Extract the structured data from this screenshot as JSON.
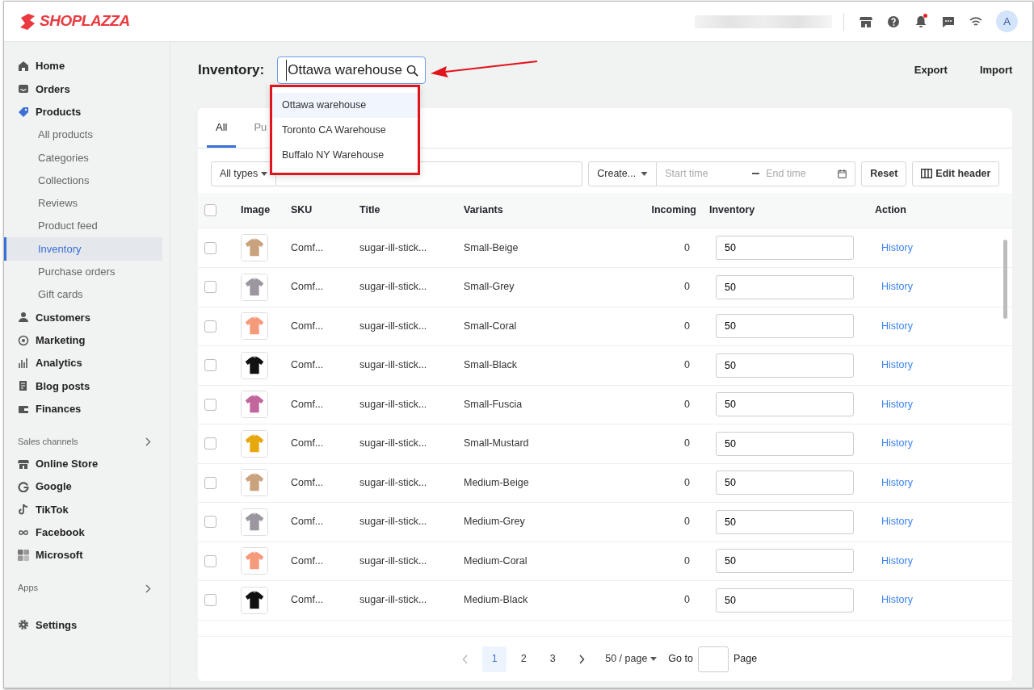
{
  "brand": {
    "name": "SHOPLAZZA"
  },
  "topbar": {
    "avatar": "A",
    "unread": true
  },
  "sidebar": {
    "items": [
      {
        "label": "Home",
        "selected": false
      },
      {
        "label": "Orders",
        "selected": false
      },
      {
        "label": "Products",
        "selected": false,
        "expanded": true,
        "children": [
          {
            "label": "All products",
            "selected": false
          },
          {
            "label": "Categories",
            "selected": false
          },
          {
            "label": "Collections",
            "selected": false
          },
          {
            "label": "Reviews",
            "selected": false
          },
          {
            "label": "Product feed",
            "selected": false
          },
          {
            "label": "Inventory",
            "selected": true
          },
          {
            "label": "Purchase orders",
            "selected": false
          },
          {
            "label": "Gift cards",
            "selected": false
          }
        ]
      },
      {
        "label": "Customers",
        "selected": false
      },
      {
        "label": "Marketing",
        "selected": false
      },
      {
        "label": "Analytics",
        "selected": false
      },
      {
        "label": "Blog posts",
        "selected": false
      },
      {
        "label": "Finances",
        "selected": false
      }
    ],
    "sections": [
      {
        "title": "Sales channels",
        "items": [
          {
            "label": "Online Store"
          },
          {
            "label": "Google"
          },
          {
            "label": "TikTok"
          },
          {
            "label": "Facebook"
          },
          {
            "label": "Microsoft"
          }
        ]
      },
      {
        "title": "Apps"
      }
    ],
    "footer_items": [
      {
        "label": "Settings"
      }
    ]
  },
  "page": {
    "title": "Inventory:",
    "location_search": {
      "value": "Ottawa warehouse"
    },
    "location_options": [
      {
        "label": "Ottawa warehouse",
        "selected": true
      },
      {
        "label": "Toronto CA Warehouse",
        "selected": false
      },
      {
        "label": "Buffalo NY Warehouse",
        "selected": false
      }
    ],
    "actions": [
      "Export",
      "Import"
    ]
  },
  "tabs": [
    {
      "label": "All",
      "selected": true
    },
    {
      "label": "Pu",
      "selected": false
    }
  ],
  "filters": {
    "type_select": "All types",
    "date_field_select": "Create...",
    "start_placeholder": "Start time",
    "end_placeholder": "End time",
    "buttons": [
      "Reset",
      "Edit header"
    ]
  },
  "table": {
    "all_checked": false,
    "columns": [
      "Image",
      "SKU",
      "Title",
      "Variants",
      "Incoming",
      "Inventory",
      "Action"
    ],
    "rows": [
      {
        "checked": false,
        "sku": "Comf...",
        "title": "sugar-ill-stick...",
        "variant": "Small-Beige",
        "incoming": "0",
        "inventory": "50",
        "action": "History"
      },
      {
        "checked": false,
        "sku": "Comf...",
        "title": "sugar-ill-stick...",
        "variant": "Small-Grey",
        "incoming": "0",
        "inventory": "50",
        "action": "History"
      },
      {
        "checked": false,
        "sku": "Comf...",
        "title": "sugar-ill-stick...",
        "variant": "Small-Coral",
        "incoming": "0",
        "inventory": "50",
        "action": "History"
      },
      {
        "checked": false,
        "sku": "Comf...",
        "title": "sugar-ill-stick...",
        "variant": "Small-Black",
        "incoming": "0",
        "inventory": "50",
        "action": "History"
      },
      {
        "checked": false,
        "sku": "Comf...",
        "title": "sugar-ill-stick...",
        "variant": "Small-Fuscia",
        "incoming": "0",
        "inventory": "50",
        "action": "History"
      },
      {
        "checked": false,
        "sku": "Comf...",
        "title": "sugar-ill-stick...",
        "variant": "Small-Mustard",
        "incoming": "0",
        "inventory": "50",
        "action": "History"
      },
      {
        "checked": false,
        "sku": "Comf...",
        "title": "sugar-ill-stick...",
        "variant": "Medium-Beige",
        "incoming": "0",
        "inventory": "50",
        "action": "History"
      },
      {
        "checked": false,
        "sku": "Comf...",
        "title": "sugar-ill-stick...",
        "variant": "Medium-Grey",
        "incoming": "0",
        "inventory": "50",
        "action": "History"
      },
      {
        "checked": false,
        "sku": "Comf...",
        "title": "sugar-ill-stick...",
        "variant": "Medium-Coral",
        "incoming": "0",
        "inventory": "50",
        "action": "History"
      },
      {
        "checked": false,
        "sku": "Comf...",
        "title": "sugar-ill-stick...",
        "variant": "Medium-Black",
        "incoming": "0",
        "inventory": "50",
        "action": "History"
      }
    ]
  },
  "pagination": {
    "prev_disabled": true,
    "pages": [
      {
        "label": "1",
        "selected": true
      },
      {
        "label": "2",
        "selected": false
      },
      {
        "label": "3",
        "selected": false
      }
    ],
    "page_size": "50 / page",
    "goto_label": "Go to",
    "page_label": "Page"
  }
}
